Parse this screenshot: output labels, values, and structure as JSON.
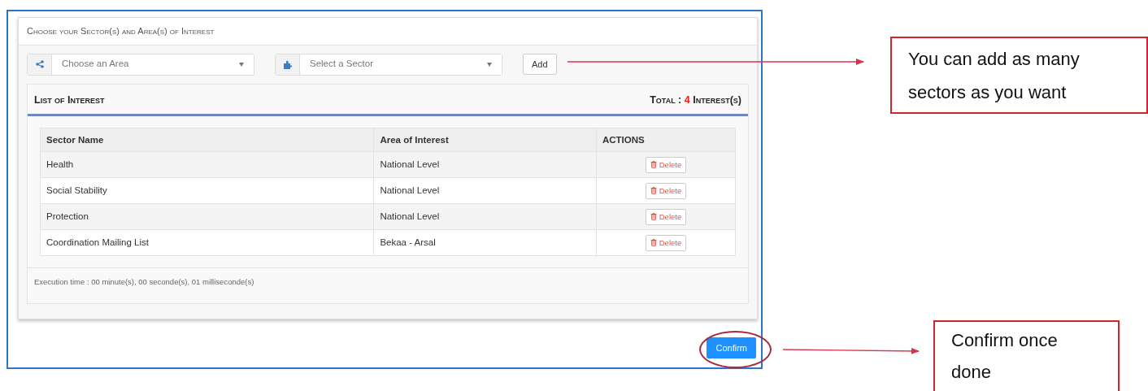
{
  "panel": {
    "title": "Choose your Sector(s) and Area(s) of Interest"
  },
  "filters": {
    "area": {
      "placeholder": "Choose an Area"
    },
    "sector": {
      "placeholder": "Select a Sector"
    },
    "add_button": "Add"
  },
  "list": {
    "title": "List of Interest",
    "total_label": "Total : ",
    "total_count": "4",
    "total_suffix": " Interest(s)"
  },
  "table": {
    "columns": [
      "Sector Name",
      "Area of Interest",
      "ACTIONS"
    ],
    "rows": [
      {
        "sector": "Health",
        "area": "National Level",
        "action": "Delete"
      },
      {
        "sector": "Social Stability",
        "area": "National Level",
        "action": "Delete"
      },
      {
        "sector": "Protection",
        "area": "National Level",
        "action": "Delete"
      },
      {
        "sector": "Coordination Mailing List",
        "area": "Bekaa - Arsal",
        "action": "Delete"
      }
    ]
  },
  "footer": "Execution time : 00 minute(s), 00 seconde(s), 01 milliseconde(s)",
  "confirm_button": "Confirm",
  "annotations": [
    {
      "text": "You can add as many sectors as you want"
    },
    {
      "text": "Confirm once done"
    }
  ]
}
